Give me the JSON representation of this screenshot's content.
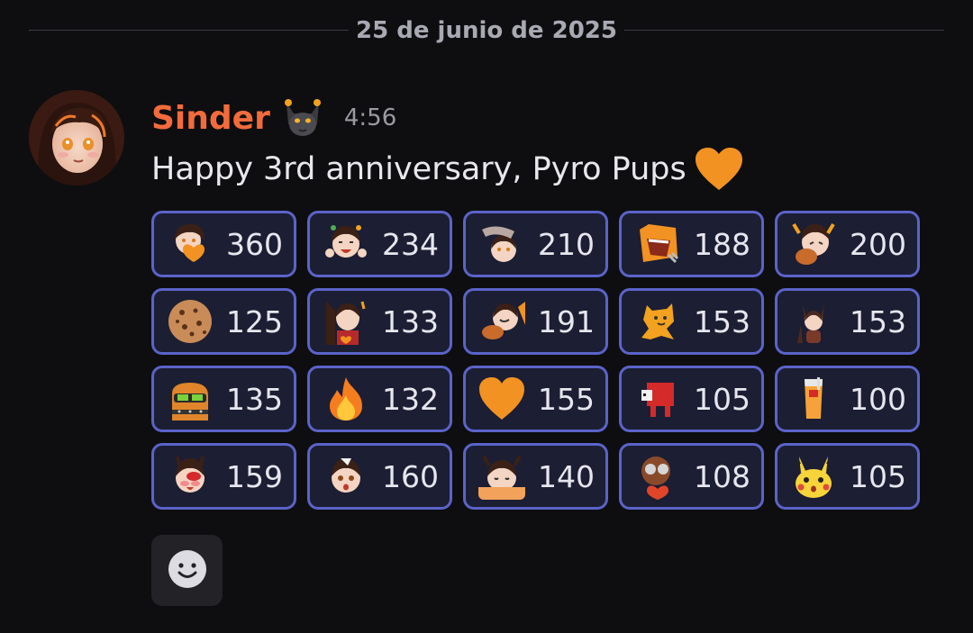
{
  "divider": {
    "date": "25 de junio de 2025"
  },
  "message": {
    "username": "Sinder",
    "time": "4:56",
    "text": "Happy 3rd anniversary, Pyro Pups",
    "text_emoji": "orange-heart-icon"
  },
  "colors": {
    "username": "#f36b3c",
    "reaction_border": "#5b63c9",
    "reaction_bg": "#1c1e33",
    "accent_orange": "#f29222"
  },
  "reactions": [
    [
      {
        "emoji": "sinder-heart-emote-icon",
        "count": "360"
      },
      {
        "emoji": "sinder-cheer-emote-icon",
        "count": "234"
      },
      {
        "emoji": "sinder-headpat-emote-icon",
        "count": "210"
      },
      {
        "emoji": "pyro-pup-scream-emote-icon",
        "count": "188"
      },
      {
        "emoji": "sinder-eat-emote-icon",
        "count": "200"
      }
    ],
    [
      {
        "emoji": "cookie-icon",
        "count": "125"
      },
      {
        "emoji": "sinder-heart-hands-emote-icon",
        "count": "133"
      },
      {
        "emoji": "sinder-snack-emote-icon",
        "count": "191"
      },
      {
        "emoji": "pyro-pup-dance-emote-icon",
        "count": "153"
      },
      {
        "emoji": "sinder-chibi-emote-icon",
        "count": "153"
      }
    ],
    [
      {
        "emoji": "pyro-pup-sunglasses-emote-icon",
        "count": "135"
      },
      {
        "emoji": "fire-icon",
        "count": "132"
      },
      {
        "emoji": "orange-heart-icon",
        "count": "155"
      },
      {
        "emoji": "red-sheep-emote-icon",
        "count": "105"
      },
      {
        "emoji": "orange-drink-emote-icon",
        "count": "100"
      }
    ],
    [
      {
        "emoji": "sinder-blush-emote-icon",
        "count": "159"
      },
      {
        "emoji": "sinder-shock-emote-icon",
        "count": "160"
      },
      {
        "emoji": "sinder-peek-emote-icon",
        "count": "140"
      },
      {
        "emoji": "pup-heart-emote-icon",
        "count": "108"
      },
      {
        "emoji": "surprised-pikachu-icon",
        "count": "105"
      }
    ]
  ],
  "add_reaction": {
    "icon": "smiley-add-reaction-icon"
  }
}
